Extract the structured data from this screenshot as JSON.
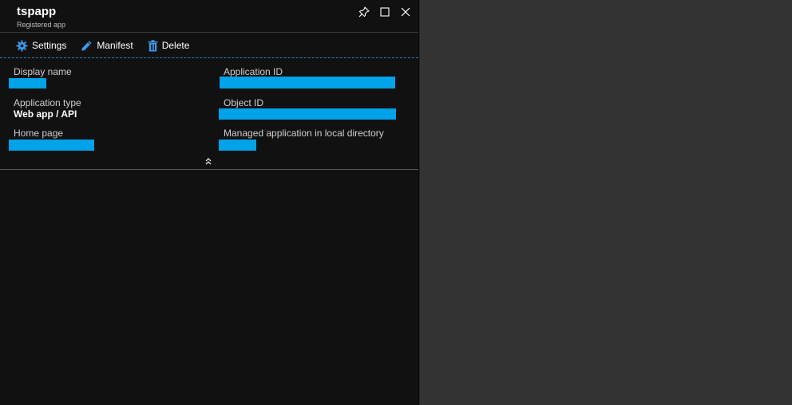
{
  "blade": {
    "title": "tspapp",
    "subtitle": "Registered app"
  },
  "header_icons": [
    "pin-icon",
    "maximize-icon",
    "close-icon"
  ],
  "toolbar": {
    "settings_label": "Settings",
    "manifest_label": "Manifest",
    "delete_label": "Delete"
  },
  "essentials": {
    "display_name_label": "Display name",
    "application_id_label": "Application ID",
    "application_type_label": "Application type",
    "application_type_value": "Web app / API",
    "object_id_label": "Object ID",
    "home_page_label": "Home page",
    "managed_app_label": "Managed application in local directory"
  },
  "colors": {
    "blade_bg": "#111111",
    "page_bg": "#333333",
    "accent": "#00a2e8",
    "icon_blue": "#3d9be9"
  }
}
